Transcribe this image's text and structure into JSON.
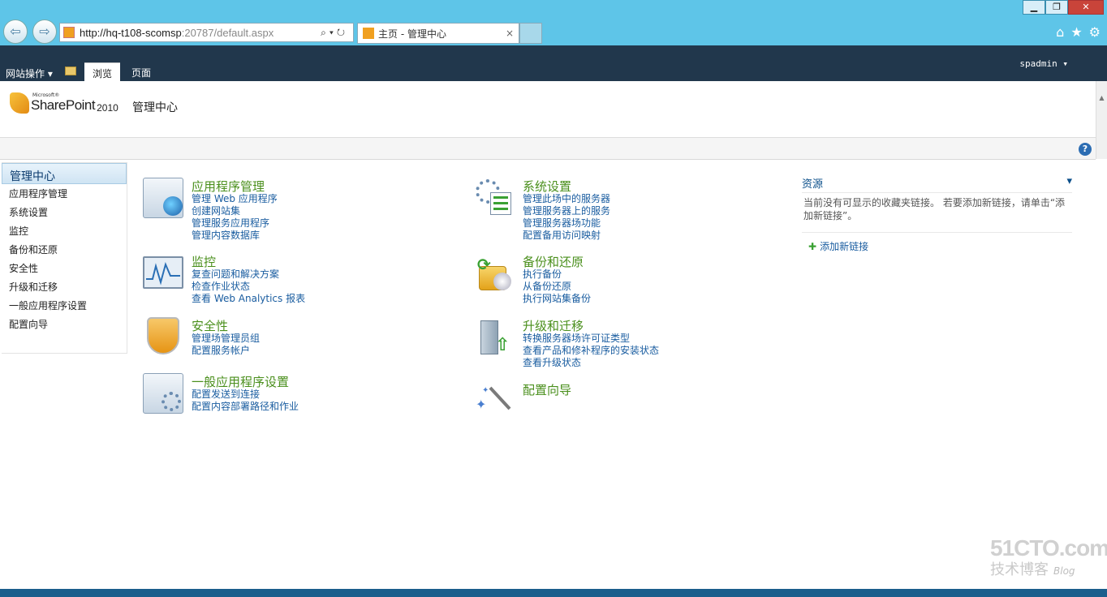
{
  "window": {
    "minimize_label": "▁",
    "maximize_label": "❐",
    "close_label": "✕"
  },
  "browser": {
    "url_main": "http://hq-t108-scomsp",
    "url_port": ":20787/default.aspx",
    "tab_title": "主页 - 管理中心",
    "tab_close": "×"
  },
  "ribbon": {
    "site_actions": "网站操作 ▾",
    "tabs": [
      "浏览",
      "页面"
    ],
    "user": "spadmin ▾"
  },
  "header": {
    "logo_ms": "Microsoft®",
    "logo_product": "SharePoint",
    "logo_year": "2010",
    "site_title": "管理中心"
  },
  "quick_launch": {
    "heading": "管理中心",
    "items": [
      "应用程序管理",
      "系统设置",
      "监控",
      "备份和还原",
      "安全性",
      "升级和迁移",
      "一般应用程序设置",
      "配置向导"
    ]
  },
  "sections": {
    "app_mgmt": {
      "title": "应用程序管理",
      "links": [
        "管理 Web 应用程序",
        "创建网站集",
        "管理服务应用程序",
        "管理内容数据库"
      ]
    },
    "monitoring": {
      "title": "监控",
      "links": [
        "复查问题和解决方案",
        "检查作业状态",
        "查看 Web Analytics 报表"
      ]
    },
    "security": {
      "title": "安全性",
      "links": [
        "管理场管理员组",
        "配置服务帐户"
      ]
    },
    "general": {
      "title": "一般应用程序设置",
      "links": [
        "配置发送到连接",
        "配置内容部署路径和作业"
      ]
    },
    "system": {
      "title": "系统设置",
      "links": [
        "管理此场中的服务器",
        "管理服务器上的服务",
        "管理服务器场功能",
        "配置备用访问映射"
      ]
    },
    "backup": {
      "title": "备份和还原",
      "links": [
        "执行备份",
        "从备份还原",
        "执行网站集备份"
      ]
    },
    "upgrade": {
      "title": "升级和迁移",
      "links": [
        "转换服务器场许可证类型",
        "查看产品和修补程序的安装状态",
        "查看升级状态"
      ]
    },
    "wizard": {
      "title": "配置向导"
    }
  },
  "resources": {
    "title": "资源",
    "menu": "▾",
    "body": "当前没有可显示的收藏夹链接。 若要添加新链接，请单击“添加新链接”。",
    "add_link": "添加新链接"
  },
  "watermark": {
    "site": "51CTO.com",
    "sub": "技术博客",
    "blog": "Blog"
  }
}
